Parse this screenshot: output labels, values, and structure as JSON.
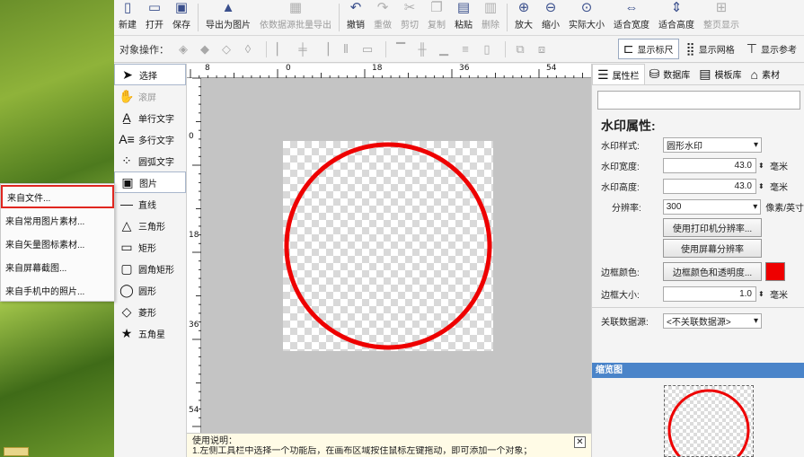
{
  "toolbar": {
    "new": "新建",
    "open": "打开",
    "save": "保存",
    "export_image": "导出为图片",
    "batch_export": "依数据源批量导出",
    "undo": "撤销",
    "redo": "重做",
    "cut": "剪切",
    "copy": "复制",
    "paste": "粘贴",
    "delete": "删除",
    "zoom_in": "放大",
    "zoom_out": "缩小",
    "actual_size": "实际大小",
    "fit_width": "适合宽度",
    "fit_height": "适合高度",
    "whole_page": "整页显示"
  },
  "obj_toolbar": {
    "label": "对象操作：",
    "show_ruler": "显示标尺",
    "show_grid": "显示网格",
    "show_ref": "显示参考"
  },
  "tools": {
    "select": "选择",
    "scroll": "滚屏",
    "single_text": "单行文字",
    "multi_text": "多行文字",
    "arc_text": "圆弧文字",
    "image": "图片",
    "line": "直线",
    "triangle": "三角形",
    "rect": "矩形",
    "round_rect": "圆角矩形",
    "circle": "圆形",
    "diamond": "菱形",
    "star": "五角星"
  },
  "image_menu": [
    "来自文件...",
    "来自常用图片素材...",
    "来自矢量图标素材...",
    "来自屏幕截图...",
    "来自手机中的照片..."
  ],
  "ruler": {
    "top_labels": [
      "8",
      "0",
      "18",
      "36",
      "54"
    ],
    "left_labels": [
      "0",
      "18",
      "36",
      "54"
    ]
  },
  "help": {
    "title": "使用说明：",
    "line1": "1.左侧工具栏中选择一个功能后，在画布区域按住鼠标左键拖动，即可添加一个对象；"
  },
  "right_panel": {
    "tabs": [
      "属性栏",
      "数据库",
      "模板库",
      "素材"
    ],
    "prop_title": "水印属性:",
    "style_label": "水印样式:",
    "style_value": "圆形水印",
    "width_label": "水印宽度:",
    "width_value": "43.0",
    "height_label": "水印高度:",
    "height_value": "43.0",
    "unit_mm": "毫米",
    "res_label": "分辨率:",
    "res_value": "300",
    "res_unit": "像素/英寸",
    "btn_printer_res": "使用打印机分辨率...",
    "btn_screen_res": "使用屏幕分辨率",
    "border_color_label": "边框颜色:",
    "btn_border_color": "边框颜色和透明度...",
    "border_color_value": "#ee0000",
    "border_size_label": "边框大小:",
    "border_size_value": "1.0",
    "datasource_label": "关联数据源:",
    "datasource_value": "<不关联数据源>",
    "preview_header": "缩览图"
  }
}
